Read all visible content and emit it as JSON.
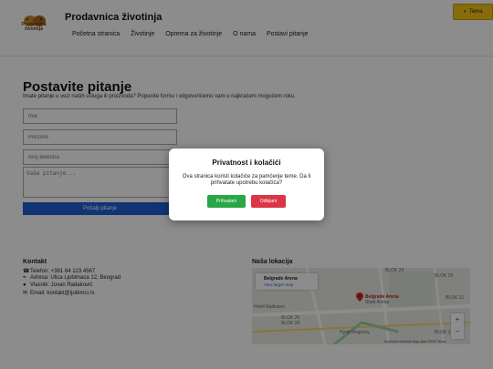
{
  "header": {
    "logo_text": "Prodavnica životinja",
    "title": "Prodavnica životinja",
    "nav": [
      "Početna stranica",
      "Životinje",
      "Oprema za životinje",
      "O nama",
      "Postavi pitanje"
    ],
    "theme_label": "Tema",
    "theme_icon": "moon-icon"
  },
  "form": {
    "title": "Postavite pitanje",
    "subtitle": "Imate pitanje u vezi naših usluga ili proizvoda? Popunite formu i odgovorićemo vam u najkraćem mogućem roku.",
    "name_placeholder": "Ime",
    "surname_placeholder": "Prezime",
    "phone_placeholder": "Broj telefona",
    "question_placeholder": "Vaše pitanje...",
    "submit_label": "Pošalji pitanje"
  },
  "contact": {
    "title": "Kontakt",
    "phone": "Telefon: +381 64 123 4567",
    "address": "Adresa: Ulica Ljubimaca 12, Beograd",
    "owner": "Vlasnik: Jovan Radaković",
    "email": "Email: kontakt@ljubimci.rs"
  },
  "location": {
    "title": "Naša lokacija",
    "map": {
      "place_name": "Belgrade Arena",
      "larger_map_link": "View larger map",
      "pin_label": "Belgrade Arena",
      "pin_sub": "Stark Arena",
      "labels": [
        "BLOK 24",
        "BLOK 25",
        "BLOK 21",
        "BLOK 26",
        "BLOK 28",
        "BLOK 22",
        "Hotel Radisson",
        "Hyatt Regency"
      ],
      "attribution": "Keyboard shortcuts   Map data ©2025   Terms"
    }
  },
  "modal": {
    "title": "Privatnost i kolačići",
    "text": "Ova stranica koristi kolačiće za pamćenje teme. Da li prihvatate upotrebu kolačića?",
    "accept_label": "Prihvatam",
    "reject_label": "Odbijam"
  },
  "colors": {
    "accept": "#29a745",
    "reject": "#dc3545",
    "submit": "#1f5fd3",
    "theme_button": "#f5c518"
  }
}
